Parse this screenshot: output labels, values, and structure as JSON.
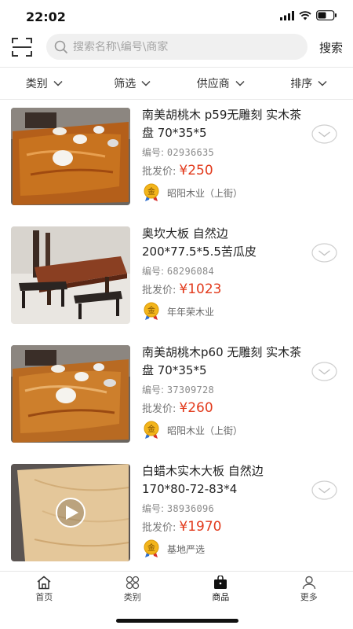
{
  "status_bar": {
    "time": "22:02"
  },
  "header": {
    "search_placeholder": "搜索名称\\编号\\商家",
    "search_button": "搜索"
  },
  "filters": [
    {
      "label": "类别"
    },
    {
      "label": "筛选"
    },
    {
      "label": "供应商"
    },
    {
      "label": "排序"
    }
  ],
  "products": [
    {
      "title": "南美胡桃木 p59无雕刻 实木茶盘 70*35*5",
      "code_label": "编号:",
      "code": "02936635",
      "price_label": "批发价:",
      "price": "¥250",
      "seller_badge": "金",
      "seller": "昭阳木业（上街）"
    },
    {
      "title": "奥坎大板 自然边 200*77.5*5.5苦瓜皮",
      "code_label": "编号:",
      "code": "68296084",
      "price_label": "批发价:",
      "price": "¥1023",
      "seller_badge": "金",
      "seller": "年年荣木业"
    },
    {
      "title": "南美胡桃木p60 无雕刻 实木茶盘 70*35*5",
      "code_label": "编号:",
      "code": "37309728",
      "price_label": "批发价:",
      "price": "¥260",
      "seller_badge": "金",
      "seller": "昭阳木业（上街）"
    },
    {
      "title": "白蜡木实木大板 自然边 170*80-72-83*4",
      "code_label": "编号:",
      "code": "38936096",
      "price_label": "批发价:",
      "price": "¥1970",
      "seller_badge": "金",
      "seller": "基地严选"
    }
  ],
  "tabs": [
    {
      "label": "首页",
      "icon": "home-icon"
    },
    {
      "label": "类别",
      "icon": "category-icon"
    },
    {
      "label": "商品",
      "icon": "bag-icon",
      "active": true
    },
    {
      "label": "更多",
      "icon": "user-icon"
    }
  ],
  "colors": {
    "price": "#e23a1c",
    "accent_active": "#111111"
  }
}
